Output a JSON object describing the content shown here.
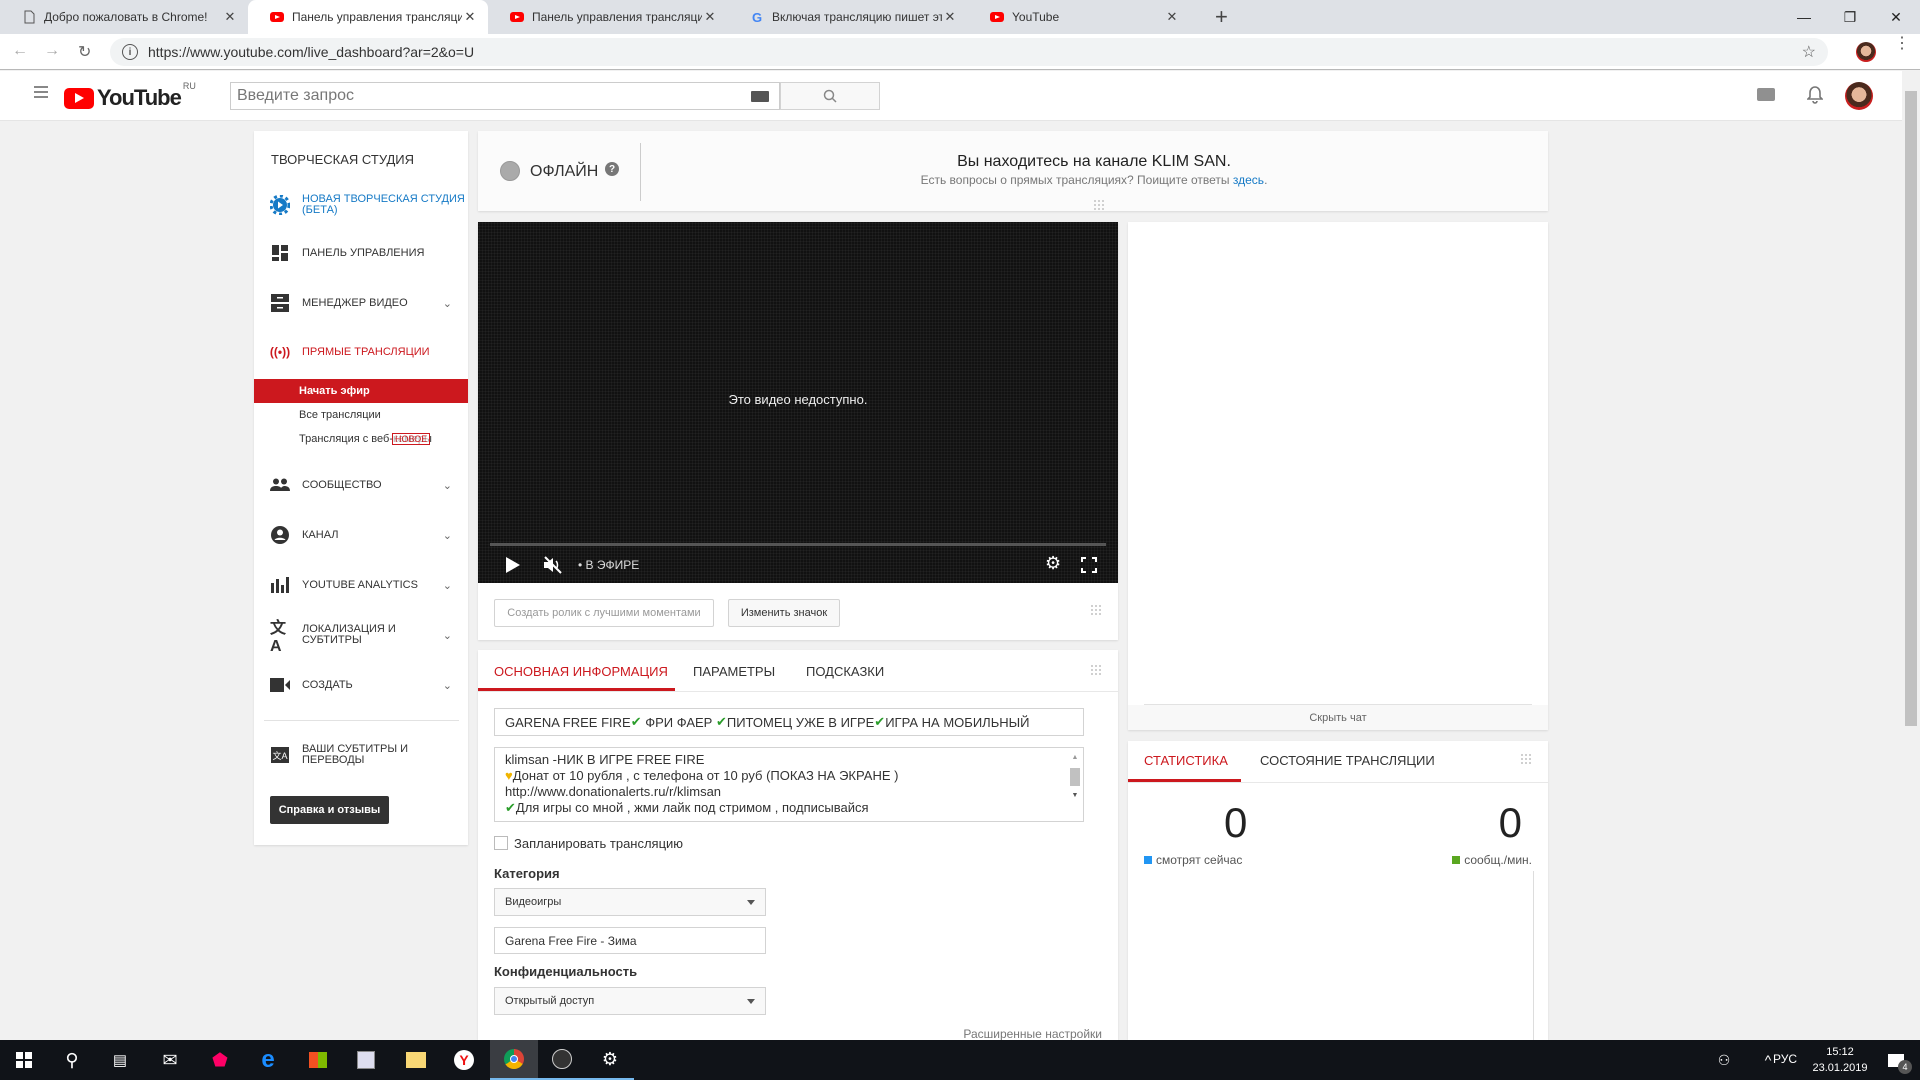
{
  "browser": {
    "tabs": [
      {
        "title": "Добро пожаловать в Chrome!",
        "icon": "page-icon",
        "active": false
      },
      {
        "title": "Панель управления трансляцией",
        "icon": "youtube-icon",
        "active": true
      },
      {
        "title": "Панель управления трансляцией",
        "icon": "youtube-icon",
        "active": false
      },
      {
        "title": "Включая трансляцию пишет это",
        "icon": "google-icon",
        "active": false
      },
      {
        "title": "YouTube",
        "icon": "youtube-icon",
        "active": false
      }
    ],
    "new_tab": "+",
    "url": "https://www.youtube.com/live_dashboard?ar=2&o=U",
    "window_controls": {
      "minimize": "—",
      "restore": "❐",
      "close": "✕"
    }
  },
  "header": {
    "logo": "YouTube",
    "region": "RU",
    "search_placeholder": "Введите запрос"
  },
  "sidebar": {
    "title": "ТВОРЧЕСКАЯ СТУДИЯ",
    "items": [
      {
        "label": "НОВАЯ ТВОРЧЕСКАЯ СТУДИЯ (БЕТА)",
        "icon": "gear-play-icon",
        "chevron": false
      },
      {
        "label": "ПАНЕЛЬ УПРАВЛЕНИЯ",
        "icon": "dashboard-icon",
        "chevron": false
      },
      {
        "label": "МЕНЕДЖЕР ВИДЕО",
        "icon": "video-manager-icon",
        "chevron": true
      },
      {
        "label": "ПРЯМЫЕ ТРАНСЛЯЦИИ",
        "icon": "live-icon",
        "chevron": false
      },
      {
        "label": "СООБЩЕСТВО",
        "icon": "community-icon",
        "chevron": true
      },
      {
        "label": "КАНАЛ",
        "icon": "channel-icon",
        "chevron": true
      },
      {
        "label": "YOUTUBE ANALYTICS",
        "icon": "analytics-icon",
        "chevron": true
      },
      {
        "label": "ЛОКАЛИЗАЦИЯ И СУБТИТРЫ",
        "icon": "translate-icon",
        "chevron": true
      },
      {
        "label": "СОЗДАТЬ",
        "icon": "create-icon",
        "chevron": true
      },
      {
        "label": "ВАШИ СУБТИТРЫ И ПЕРЕВОДЫ",
        "icon": "subtitles-icon",
        "chevron": false
      }
    ],
    "live_sub": [
      {
        "label": "Начать эфир",
        "active": true
      },
      {
        "label": "Все трансляции",
        "active": false
      },
      {
        "label": "Трансляция с веб-камеры",
        "active": false,
        "badge": "НОВОЕ"
      }
    ],
    "help_button": "Справка и отзывы"
  },
  "status": {
    "state": "ОФЛАЙН",
    "channel_msg": "Вы находитесь на канале KLIM SAN.",
    "question": "Есть вопросы о прямых трансляциях? Поищите ответы ",
    "link": "здесь",
    "dot": "."
  },
  "player": {
    "message": "Это видео недоступно.",
    "live_label": "• В ЭФИРЕ",
    "highlight_button": "Создать ролик с лучшими моментами",
    "thumbnail_button": "Изменить значок"
  },
  "info": {
    "tabs": [
      {
        "label": "ОСНОВНАЯ ИНФОРМАЦИЯ",
        "active": true
      },
      {
        "label": "ПАРАМЕТРЫ",
        "active": false
      },
      {
        "label": "ПОДСКАЗКИ",
        "active": false
      }
    ],
    "title_parts": [
      "GARENA FREE FIRE",
      " ФРИ ФАЕР ",
      "ПИТОМЕЦ УЖЕ В ИГРЕ",
      "ИГРА НА МОБИЛЬНЫЙ"
    ],
    "description_lines": [
      "klimsan  -НИК В ИГРЕ  FREE FIRE",
      "Донат от 10 рубля , с телефона от 10 руб (ПОКАЗ НА ЭКРАНЕ )",
      "http://www.donationalerts.ru/r/klimsan",
      "Для игры со мной , жми лайк под стримом , подписывайся"
    ],
    "schedule_label": "Запланировать трансляцию",
    "schedule_checked": false,
    "category_label": "Категория",
    "category_value": "Видеоигры",
    "game_value": "Garena Free Fire - Зима",
    "privacy_label": "Конфиденциальность",
    "privacy_value": "Открытый доступ",
    "advanced_link": "Расширенные настройки"
  },
  "chat": {
    "hide_label": "Скрыть чат"
  },
  "stats": {
    "tabs": [
      {
        "label": "СТАТИСТИКА",
        "active": true
      },
      {
        "label": "СОСТОЯНИЕ ТРАНСЛЯЦИИ",
        "active": false
      }
    ],
    "viewers_value": "0",
    "viewers_label": "смотрят сейчас",
    "viewers_color": "#2196f3",
    "messages_value": "0",
    "messages_label": "сообщ./мин.",
    "messages_color": "#5aa720"
  },
  "taskbar": {
    "language": "РУС",
    "time": "15:12",
    "date": "23.01.2019",
    "notifications": "4"
  },
  "colors": {
    "accent": "#cc181e",
    "link": "#167ac6"
  }
}
